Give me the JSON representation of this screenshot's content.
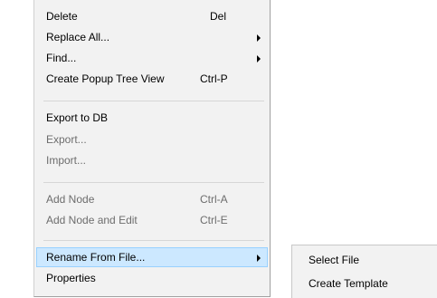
{
  "context_menu": {
    "items": [
      {
        "label": "Delete",
        "shortcut": "Del"
      },
      {
        "label": "Replace All..."
      },
      {
        "label": "Find..."
      },
      {
        "label": "Create Popup Tree View",
        "shortcut": "Ctrl-P"
      },
      {
        "label": "Export to DB"
      },
      {
        "label": "Export..."
      },
      {
        "label": "Import..."
      },
      {
        "label": "Add Node",
        "shortcut": "Ctrl-A"
      },
      {
        "label": "Add Node and Edit",
        "shortcut": "Ctrl-E"
      },
      {
        "label": "Rename From File..."
      },
      {
        "label": "Properties"
      }
    ],
    "submenu_arrow_icon": "chevron-right-icon",
    "highlight_color": "#cce8ff",
    "disabled_text_color": "#6d6d6d"
  },
  "rename_submenu": {
    "items": [
      {
        "label": "Select File"
      },
      {
        "label": "Create Template"
      }
    ]
  }
}
